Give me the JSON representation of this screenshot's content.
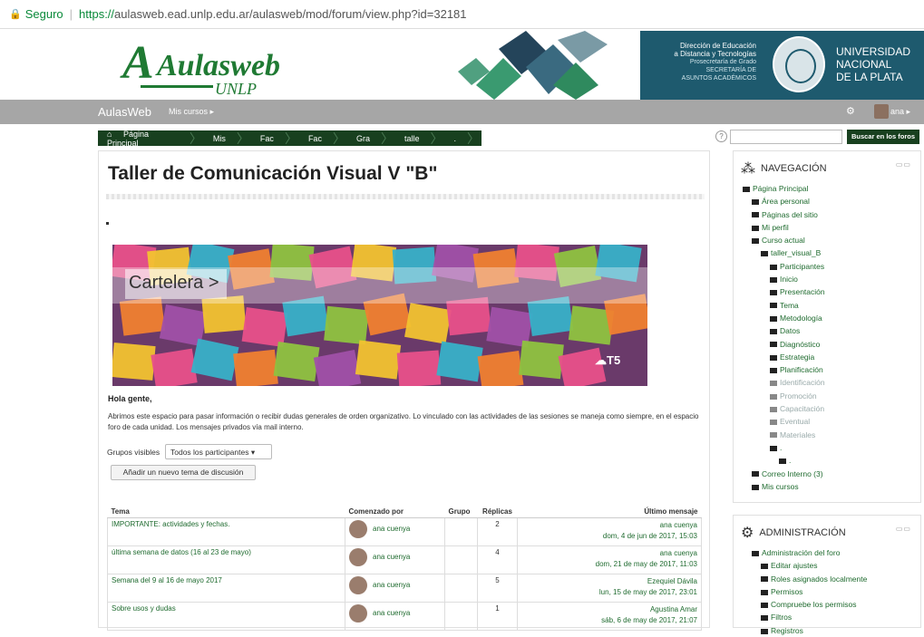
{
  "browser": {
    "secure_label": "Seguro",
    "url_https": "https://",
    "url_rest": "aulasweb.ead.unlp.edu.ar/aulasweb/mod/forum/view.php?id=32181"
  },
  "banner": {
    "logo_text": "Aulasweb",
    "logo_sub": "UNLP",
    "dept_lines": [
      "Dirección de Educación",
      "a Distancia y Tecnologías",
      "Prosecretaría de Grado",
      "SECRETARÍA DE",
      "ASUNTOS ACADÉMICOS"
    ],
    "uni_lines": [
      "UNIVERSIDAD",
      "NACIONAL",
      "DE LA PLATA"
    ]
  },
  "navbar": {
    "brand": "AulasWeb",
    "my_courses": "Mis cursos ▸",
    "user": "ana ▸"
  },
  "breadcrumb": [
    "Página Principal",
    "Mis",
    "Fac",
    "Fac",
    "Gra",
    "talle",
    "."
  ],
  "search": {
    "button": "Buscar en los foros"
  },
  "main": {
    "title": "Taller de Comunicación Visual V \"B\"",
    "banner_label": "Cartelera >",
    "banner_badge": "T5",
    "greeting": "Hola gente,",
    "description": "Abrimos este espacio para pasar información o recibir dudas generales de orden organizativo. Lo vinculado con las actividades de las sesiones se maneja como siempre, en el espacio foro de cada unidad. Los mensajes privados vía mail interno.",
    "groups_label": "Grupos visibles",
    "groups_value": "Todos los participantes",
    "add_button": "Añadir un nuevo tema de discusión",
    "table": {
      "headers": [
        "Tema",
        "Comenzado por",
        "Grupo",
        "Réplicas",
        "Último mensaje"
      ],
      "rows": [
        {
          "topic": "IMPORTANTE: actividades y fechas.",
          "author": "ana cuenya",
          "group": "",
          "replies": "2",
          "last_user": "ana cuenya",
          "last_date": "dom, 4 de jun de 2017, 15:03"
        },
        {
          "topic": "última semana de datos (16 al 23 de mayo)",
          "author": "ana cuenya",
          "group": "",
          "replies": "4",
          "last_user": "ana cuenya",
          "last_date": "dom, 21 de may de 2017, 11:03"
        },
        {
          "topic": "Semana del 9 al 16 de mayo 2017",
          "author": "ana cuenya",
          "group": "",
          "replies": "5",
          "last_user": "Ezequiel Dávila",
          "last_date": "lun, 15 de may de 2017, 23:01"
        },
        {
          "topic": "Sobre usos y dudas",
          "author": "ana cuenya",
          "group": "",
          "replies": "1",
          "last_user": "Agustina Amar",
          "last_date": "sáb, 6 de may de 2017, 21:07"
        }
      ]
    }
  },
  "navigation": {
    "title": "NAVEGACIÓN",
    "items": [
      {
        "label": "Página Principal",
        "indent": 0,
        "dim": false
      },
      {
        "label": "Área personal",
        "indent": 1,
        "dim": false
      },
      {
        "label": "Páginas del sitio",
        "indent": 1,
        "dim": false
      },
      {
        "label": "Mi perfil",
        "indent": 1,
        "dim": false
      },
      {
        "label": "Curso actual",
        "indent": 1,
        "dim": false
      },
      {
        "label": "taller_visual_B",
        "indent": 2,
        "dim": false
      },
      {
        "label": "Participantes",
        "indent": 3,
        "dim": false
      },
      {
        "label": "Inicio",
        "indent": 3,
        "dim": false
      },
      {
        "label": "Presentación",
        "indent": 3,
        "dim": false
      },
      {
        "label": "Tema",
        "indent": 3,
        "dim": false
      },
      {
        "label": "Metodología",
        "indent": 3,
        "dim": false
      },
      {
        "label": "Datos",
        "indent": 3,
        "dim": false
      },
      {
        "label": "Diagnóstico",
        "indent": 3,
        "dim": false
      },
      {
        "label": "Estrategia",
        "indent": 3,
        "dim": false
      },
      {
        "label": "Planificación",
        "indent": 3,
        "dim": false
      },
      {
        "label": "Identificación",
        "indent": 3,
        "dim": true
      },
      {
        "label": "Promoción",
        "indent": 3,
        "dim": true
      },
      {
        "label": "Capacitación",
        "indent": 3,
        "dim": true
      },
      {
        "label": "Eventual",
        "indent": 3,
        "dim": true
      },
      {
        "label": "Materiales",
        "indent": 3,
        "dim": true
      },
      {
        "label": ".",
        "indent": 3,
        "dim": false
      },
      {
        "label": ".",
        "indent": 4,
        "dim": false
      },
      {
        "label": "Correo Interno (3)",
        "indent": 1,
        "dim": false
      },
      {
        "label": "Mis cursos",
        "indent": 1,
        "dim": false
      }
    ]
  },
  "administration": {
    "title": "ADMINISTRACIÓN",
    "items": [
      {
        "label": "Administración del foro",
        "indent": 1
      },
      {
        "label": "Editar ajustes",
        "indent": 2
      },
      {
        "label": "Roles asignados localmente",
        "indent": 2
      },
      {
        "label": "Permisos",
        "indent": 2
      },
      {
        "label": "Compruebe los permisos",
        "indent": 2
      },
      {
        "label": "Filtros",
        "indent": 2
      },
      {
        "label": "Registros",
        "indent": 2
      }
    ]
  },
  "colors": {
    "nav_green": "#18401f",
    "link_green": "#1f6b2f",
    "navbar_gray": "#a6a6a6",
    "uni_teal": "#1e5a6e"
  }
}
